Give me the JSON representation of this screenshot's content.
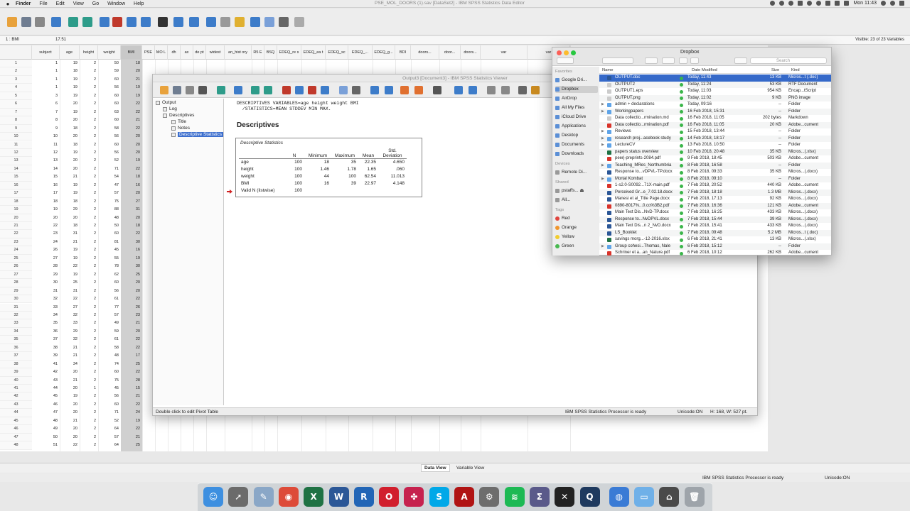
{
  "menubar": {
    "apple": "",
    "items": [
      "Finder",
      "File",
      "Edit",
      "View",
      "Go",
      "Window",
      "Help"
    ],
    "window_title": "PSE_MOL_DOORS (1).sav [DataSet2] - IBM SPSS Statistics Data Editor",
    "clock": "Mon 11:43"
  },
  "editor": {
    "cell_ref": "1 : BMI",
    "cell_value": "17.51",
    "visible": "Visible: 23 of 23 Variables",
    "columns": [
      "subject",
      "age",
      "height",
      "weight",
      "BMI",
      "PSE",
      "MO L",
      "dh",
      "ax",
      "de pt",
      "widest",
      "an_hist ory",
      "R5 E",
      "BSQ",
      "EDEQ_re s",
      "EDEQ_ea t",
      "EDEQ_sc",
      "EDEQ_...",
      "EDEQ_g...",
      "BDI",
      "doors...",
      "door...",
      "doors...",
      "var",
      "var"
    ],
    "rows": [
      [
        "1",
        "1",
        "19",
        "2",
        "50",
        "18"
      ],
      [
        "2",
        "1",
        "18",
        "2",
        "59",
        "20"
      ],
      [
        "3",
        "1",
        "19",
        "2",
        "60",
        "21"
      ],
      [
        "4",
        "1",
        "19",
        "2",
        "56",
        "19"
      ],
      [
        "5",
        "3",
        "19",
        "2",
        "60",
        "19"
      ],
      [
        "6",
        "6",
        "20",
        "2",
        "60",
        "22"
      ],
      [
        "7",
        "7",
        "19",
        "2",
        "63",
        "22"
      ],
      [
        "8",
        "8",
        "20",
        "2",
        "60",
        "21"
      ],
      [
        "9",
        "9",
        "18",
        "2",
        "58",
        "22"
      ],
      [
        "10",
        "10",
        "20",
        "2",
        "56",
        "20"
      ],
      [
        "11",
        "11",
        "18",
        "2",
        "60",
        "20"
      ],
      [
        "12",
        "12",
        "19",
        "2",
        "56",
        "20"
      ],
      [
        "13",
        "13",
        "20",
        "2",
        "52",
        "19"
      ],
      [
        "14",
        "14",
        "20",
        "2",
        "71",
        "22"
      ],
      [
        "15",
        "15",
        "21",
        "2",
        "54",
        "18"
      ],
      [
        "16",
        "16",
        "19",
        "2",
        "47",
        "16"
      ],
      [
        "17",
        "17",
        "19",
        "2",
        "57",
        "20"
      ],
      [
        "18",
        "18",
        "18",
        "2",
        "75",
        "27"
      ],
      [
        "19",
        "19",
        "29",
        "2",
        "88",
        "31"
      ],
      [
        "20",
        "20",
        "20",
        "2",
        "48",
        "20"
      ],
      [
        "21",
        "22",
        "18",
        "2",
        "50",
        "18"
      ],
      [
        "22",
        "23",
        "31",
        "2",
        "60",
        "22"
      ],
      [
        "23",
        "24",
        "21",
        "2",
        "81",
        "30"
      ],
      [
        "24",
        "26",
        "19",
        "2",
        "45",
        "16"
      ],
      [
        "25",
        "27",
        "19",
        "2",
        "55",
        "19"
      ],
      [
        "26",
        "28",
        "22",
        "2",
        "78",
        "30"
      ],
      [
        "27",
        "29",
        "19",
        "2",
        "62",
        "25"
      ],
      [
        "28",
        "30",
        "25",
        "2",
        "60",
        "20"
      ],
      [
        "29",
        "31",
        "31",
        "2",
        "56",
        "20"
      ],
      [
        "30",
        "32",
        "22",
        "2",
        "61",
        "22"
      ],
      [
        "31",
        "33",
        "27",
        "2",
        "77",
        "26"
      ],
      [
        "32",
        "34",
        "32",
        "2",
        "57",
        "23"
      ],
      [
        "33",
        "35",
        "33",
        "2",
        "49",
        "21"
      ],
      [
        "34",
        "36",
        "29",
        "2",
        "59",
        "20"
      ],
      [
        "35",
        "37",
        "32",
        "2",
        "61",
        "22"
      ],
      [
        "36",
        "38",
        "21",
        "2",
        "58",
        "22"
      ],
      [
        "37",
        "39",
        "21",
        "2",
        "48",
        "17"
      ],
      [
        "38",
        "41",
        "34",
        "2",
        "74",
        "25"
      ],
      [
        "39",
        "42",
        "20",
        "2",
        "60",
        "22"
      ],
      [
        "40",
        "43",
        "21",
        "2",
        "75",
        "28"
      ],
      [
        "41",
        "44",
        "20",
        "1",
        "45",
        "15"
      ],
      [
        "42",
        "45",
        "19",
        "2",
        "56",
        "21"
      ],
      [
        "43",
        "46",
        "20",
        "2",
        "60",
        "22"
      ],
      [
        "44",
        "47",
        "20",
        "2",
        "71",
        "24"
      ],
      [
        "45",
        "48",
        "21",
        "2",
        "52",
        "19"
      ],
      [
        "46",
        "49",
        "20",
        "2",
        "64",
        "22"
      ],
      [
        "47",
        "50",
        "20",
        "2",
        "57",
        "21"
      ],
      [
        "48",
        "51",
        "22",
        "2",
        "64",
        "25"
      ]
    ],
    "tabs": [
      "Data View",
      "Variable View"
    ],
    "status": "IBM SPSS Statistics Processor is ready",
    "unicode": "Unicode:ON"
  },
  "viewer": {
    "title": "Output3 [Document3] - IBM SPSS Statistics Viewer",
    "outline": [
      "Output",
      "Log",
      "Descriptives",
      "Title",
      "Notes",
      "Descriptive Statistics"
    ],
    "syntax": "DESCRIPTIVES VARIABLES=age height weight BMI\n  /STATISTICS=MEAN STDDEV MIN MAX.",
    "heading": "Descriptives",
    "table": {
      "title": "Descriptive Statistics",
      "headers": [
        "",
        "N",
        "Minimum",
        "Maximum",
        "Mean",
        "Std. Deviation"
      ],
      "rows": [
        [
          "age",
          "100",
          "18",
          "35",
          "22.35",
          "4.650"
        ],
        [
          "height",
          "100",
          "1.46",
          "1.78",
          "1.65",
          ".060"
        ],
        [
          "weight",
          "100",
          "44",
          "100",
          "62.54",
          "11.013"
        ],
        [
          "BMI",
          "100",
          "16",
          "39",
          "22.97",
          "4.148"
        ],
        [
          "Valid N (listwise)",
          "100",
          "",
          "",
          "",
          ""
        ]
      ]
    },
    "status_left": "Double click to edit Pivot Table",
    "status_mid": "IBM SPSS Statistics Processor is ready",
    "status_unicode": "Unicode:ON",
    "status_dims": "H: 168, W: 527 pt."
  },
  "finder": {
    "title": "Dropbox",
    "search_placeholder": "Search",
    "favorites_label": "Favorites",
    "favorites": [
      "Google Dri...",
      "Dropbox",
      "AirDrop",
      "All My Files",
      "iCloud Drive",
      "Applications",
      "Desktop",
      "Documents",
      "Downloads"
    ],
    "devices_label": "Devices",
    "devices": [
      "Remote Di..."
    ],
    "shared_label": "Shared",
    "shared": [
      "pstaffs... ⏏",
      "All..."
    ],
    "tags_label": "Tags",
    "tags": [
      {
        "name": "Red",
        "color": "#e0443e"
      },
      {
        "name": "Orange",
        "color": "#f0952c"
      },
      {
        "name": "Yellow",
        "color": "#f2cd2f"
      },
      {
        "name": "Green",
        "color": "#48b950"
      }
    ],
    "columns": [
      "Name",
      "Date Modified",
      "Size",
      "Kind"
    ],
    "files": [
      {
        "name": "OUTPUT.doc",
        "date": "Today, 11:43",
        "size": "13 KB",
        "kind": "Micros...t (.doc)",
        "folder": false,
        "icon": "#2b5797"
      },
      {
        "name": "OUTPUT2",
        "date": "Today, 11:24",
        "size": "53 KB",
        "kind": "RTF Document",
        "folder": false,
        "icon": "#cccccc"
      },
      {
        "name": "OUTPUT1.eps",
        "date": "Today, 11:03",
        "size": "954 KB",
        "kind": "Encap...tScript",
        "folder": false,
        "icon": "#cccccc"
      },
      {
        "name": "OUTPUT.png",
        "date": "Today, 11:02",
        "size": "9 KB",
        "kind": "PNG image",
        "folder": false,
        "icon": "#cccccc"
      },
      {
        "name": "admin + declarations",
        "date": "Today, 09:16",
        "size": "--",
        "kind": "Folder",
        "folder": true,
        "icon": "#5fa4e8"
      },
      {
        "name": "Workingpapers",
        "date": "16 Feb 2018, 15:31",
        "size": "--",
        "kind": "Folder",
        "folder": true,
        "icon": "#5fa4e8"
      },
      {
        "name": "Data collectio...rmination.md",
        "date": "16 Feb 2018, 11:05",
        "size": "202 bytes",
        "kind": "Markdown",
        "folder": false,
        "icon": "#cccccc"
      },
      {
        "name": "Data collectio...rmination.pdf",
        "date": "16 Feb 2018, 11:05",
        "size": "20 KB",
        "kind": "Adobe...cument",
        "folder": false,
        "icon": "#d9342b"
      },
      {
        "name": "Reviews",
        "date": "15 Feb 2018, 13:44",
        "size": "--",
        "kind": "Folder",
        "folder": true,
        "icon": "#5fa4e8"
      },
      {
        "name": "research proj...acebook study",
        "date": "14 Feb 2018, 18:17",
        "size": "--",
        "kind": "Folder",
        "folder": true,
        "icon": "#5fa4e8"
      },
      {
        "name": "LectureCV",
        "date": "13 Feb 2018, 10:50",
        "size": "--",
        "kind": "Folder",
        "folder": true,
        "icon": "#5fa4e8"
      },
      {
        "name": "papers status overview",
        "date": "10 Feb 2018, 20:48",
        "size": "35 KB",
        "kind": "Micros...(.xlsx)",
        "folder": false,
        "icon": "#1f7244"
      },
      {
        "name": "peerj-preprints-2084.pdf",
        "date": "9 Feb 2018, 18:45",
        "size": "503 KB",
        "kind": "Adobe...cument",
        "folder": false,
        "icon": "#d9342b"
      },
      {
        "name": "Teaching_MRes_Northumbria",
        "date": "8 Feb 2018, 16:58",
        "size": "--",
        "kind": "Folder",
        "folder": true,
        "icon": "#5fa4e8"
      },
      {
        "name": "Response to...vDPVL-TP.docx",
        "date": "8 Feb 2018, 09:33",
        "size": "35 KB",
        "kind": "Micros...(.docx)",
        "folder": false,
        "icon": "#2b5797"
      },
      {
        "name": "Mortal Kombat",
        "date": "8 Feb 2018, 09:10",
        "size": "--",
        "kind": "Folder",
        "folder": true,
        "icon": "#5fa4e8"
      },
      {
        "name": "1-s2.0-S0092...71X-main.pdf",
        "date": "7 Feb 2018, 20:52",
        "size": "440 KB",
        "kind": "Adobe...cument",
        "folder": false,
        "icon": "#d9342b"
      },
      {
        "name": "Perceived Gr...e_7.02.18.docx",
        "date": "7 Feb 2018, 18:18",
        "size": "1.3 MB",
        "kind": "Micros...(.docx)",
        "folder": false,
        "icon": "#2b5797"
      },
      {
        "name": "Manesi et al_Title Page.docx",
        "date": "7 Feb 2018, 17:13",
        "size": "92 KB",
        "kind": "Micros...(.docx)",
        "folder": false,
        "icon": "#2b5797"
      },
      {
        "name": "0890-8017%...0.co%3B2.pdf",
        "date": "7 Feb 2018, 16:36",
        "size": "121 KB",
        "kind": "Adobe...cument",
        "folder": false,
        "icon": "#d9342b"
      },
      {
        "name": "Main Text Dis...NvD-TP.docx",
        "date": "7 Feb 2018, 16:25",
        "size": "433 KB",
        "kind": "Micros...(.docx)",
        "folder": false,
        "icon": "#2b5797"
      },
      {
        "name": "Response to...NvDPVL.docx",
        "date": "7 Feb 2018, 15:44",
        "size": "39 KB",
        "kind": "Micros...(.docx)",
        "folder": false,
        "icon": "#2b5797"
      },
      {
        "name": "Main Text Dis...n 2_NvD.docx",
        "date": "7 Feb 2018, 15:41",
        "size": "433 KB",
        "kind": "Micros...(.docx)",
        "folder": false,
        "icon": "#2b5797"
      },
      {
        "name": "LS_Booklet",
        "date": "7 Feb 2018, 09:48",
        "size": "5.2 MB",
        "kind": "Micros...t (.doc)",
        "folder": false,
        "icon": "#2b5797"
      },
      {
        "name": "savings morg...-12-2016.xlsx",
        "date": "6 Feb 2018, 21:41",
        "size": "13 KB",
        "kind": "Micros...(.xlsx)",
        "folder": false,
        "icon": "#1f7244"
      },
      {
        "name": "Group cohesi...Thomas, Nale",
        "date": "6 Feb 2018, 15:12",
        "size": "--",
        "kind": "Folder",
        "folder": true,
        "icon": "#5fa4e8"
      },
      {
        "name": "Schriner et a...an_Nature.pdf",
        "date": "6 Feb 2018, 10:12",
        "size": "262 KB",
        "kind": "Adobe...cument",
        "folder": false,
        "icon": "#d9342b"
      }
    ]
  },
  "dock": {
    "apps": [
      {
        "name": "Finder",
        "color": "#3d8fe0",
        "glyph": "☺"
      },
      {
        "name": "Launchpad",
        "color": "#6b6b6b",
        "glyph": "➚"
      },
      {
        "name": "Preview",
        "color": "#8aa7c7",
        "glyph": "✎"
      },
      {
        "name": "Chrome",
        "color": "#dd4b39",
        "glyph": "◉"
      },
      {
        "name": "Excel",
        "color": "#1f7244",
        "glyph": "X"
      },
      {
        "name": "Word",
        "color": "#2b5797",
        "glyph": "W"
      },
      {
        "name": "R",
        "color": "#2165b6",
        "glyph": "R"
      },
      {
        "name": "Opera",
        "color": "#d11f2d",
        "glyph": "O"
      },
      {
        "name": "Meetup",
        "color": "#c6224e",
        "glyph": "✤"
      },
      {
        "name": "Skype",
        "color": "#00a8e8",
        "glyph": "S"
      },
      {
        "name": "Acrobat",
        "color": "#b01414",
        "glyph": "A"
      },
      {
        "name": "System Preferences",
        "color": "#6d6d6d",
        "glyph": "⚙"
      },
      {
        "name": "Spotify",
        "color": "#1db954",
        "glyph": "≋"
      },
      {
        "name": "Scientific Calculator",
        "color": "#5a5a8a",
        "glyph": "Σ"
      },
      {
        "name": "X11",
        "color": "#222222",
        "glyph": "✕"
      },
      {
        "name": "QuickTime",
        "color": "#1f3a5f",
        "glyph": "Q"
      },
      {
        "name": "Network",
        "color": "#3a7bd5",
        "glyph": "◍"
      },
      {
        "name": "Folder",
        "color": "#6fb0e8",
        "glyph": "▭"
      },
      {
        "name": "Utility",
        "color": "#4a4a4a",
        "glyph": "⌂"
      },
      {
        "name": "Trash",
        "color": "#9ea4aa",
        "glyph": "🗑"
      }
    ]
  }
}
